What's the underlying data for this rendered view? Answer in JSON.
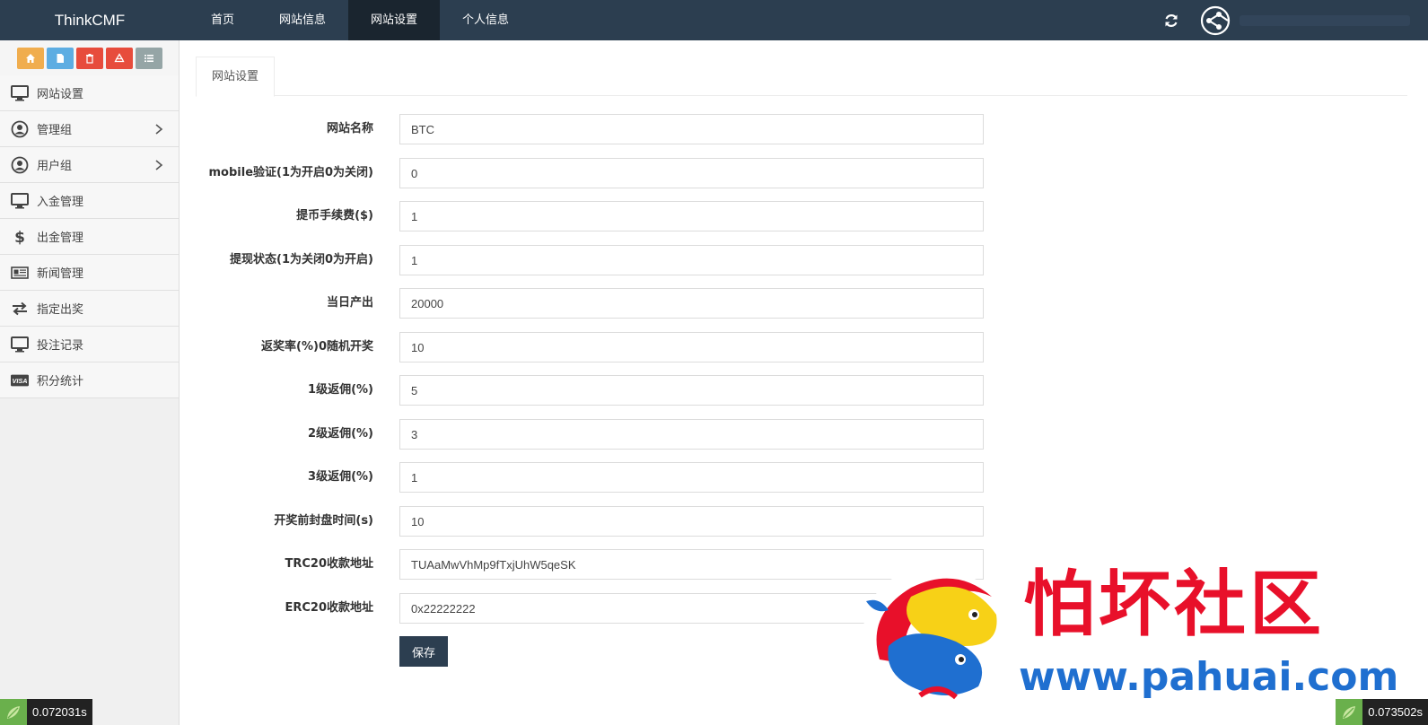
{
  "app": {
    "brand": "ThinkCMF"
  },
  "topnav": {
    "items": [
      {
        "label": "首页"
      },
      {
        "label": "网站信息"
      },
      {
        "label": "网站设置"
      },
      {
        "label": "个人信息"
      }
    ],
    "active_index": 2
  },
  "sidebar": {
    "shortcuts": [
      "home-icon",
      "file-icon",
      "trash-icon",
      "recycle-icon",
      "list-icon"
    ],
    "items": [
      {
        "label": "网站设置",
        "icon": "monitor-icon"
      },
      {
        "label": "管理组",
        "icon": "user-circle-icon",
        "has_submenu": true
      },
      {
        "label": "用户组",
        "icon": "user-circle-icon",
        "has_submenu": true
      },
      {
        "label": "入金管理",
        "icon": "monitor-icon"
      },
      {
        "label": "出金管理",
        "icon": "dollar-icon"
      },
      {
        "label": "新闻管理",
        "icon": "newspaper-icon"
      },
      {
        "label": "指定出奖",
        "icon": "exchange-icon"
      },
      {
        "label": "投注记录",
        "icon": "monitor-icon"
      },
      {
        "label": "积分统计",
        "icon": "visa-icon"
      }
    ]
  },
  "main": {
    "tab": "网站设置",
    "fields": [
      {
        "label": "网站名称",
        "value": "BTC"
      },
      {
        "label": "mobile验证(1为开启0为关闭)",
        "value": "0"
      },
      {
        "label": "提币手续费($)",
        "value": "1"
      },
      {
        "label": "提现状态(1为关闭0为开启)",
        "value": "1"
      },
      {
        "label": "当日产出",
        "value": "20000"
      },
      {
        "label": "返奖率(%)0随机开奖",
        "value": "10"
      },
      {
        "label": "1级返佣(%)",
        "value": "5"
      },
      {
        "label": "2级返佣(%)",
        "value": "3"
      },
      {
        "label": "3级返佣(%)",
        "value": "1"
      },
      {
        "label": "开奖前封盘时间(s)",
        "value": "10"
      },
      {
        "label": "TRC20收款地址",
        "value": "TUAaMwVhMp9fTxjUhW5qeSK"
      },
      {
        "label": "ERC20收款地址",
        "value": "0x22222222"
      }
    ],
    "save_label": "保存"
  },
  "debug": {
    "left_time": "0.072031s",
    "right_time": "0.073502s"
  },
  "watermark": {
    "title": "怕坏社区",
    "url": "www.pahuai.com"
  },
  "colors": {
    "topbar": "#2c3e50",
    "topbar_active": "#1a252f",
    "save_button": "#2c3e50",
    "watermark_red": "#e8102a",
    "watermark_blue": "#1f6fd0"
  }
}
